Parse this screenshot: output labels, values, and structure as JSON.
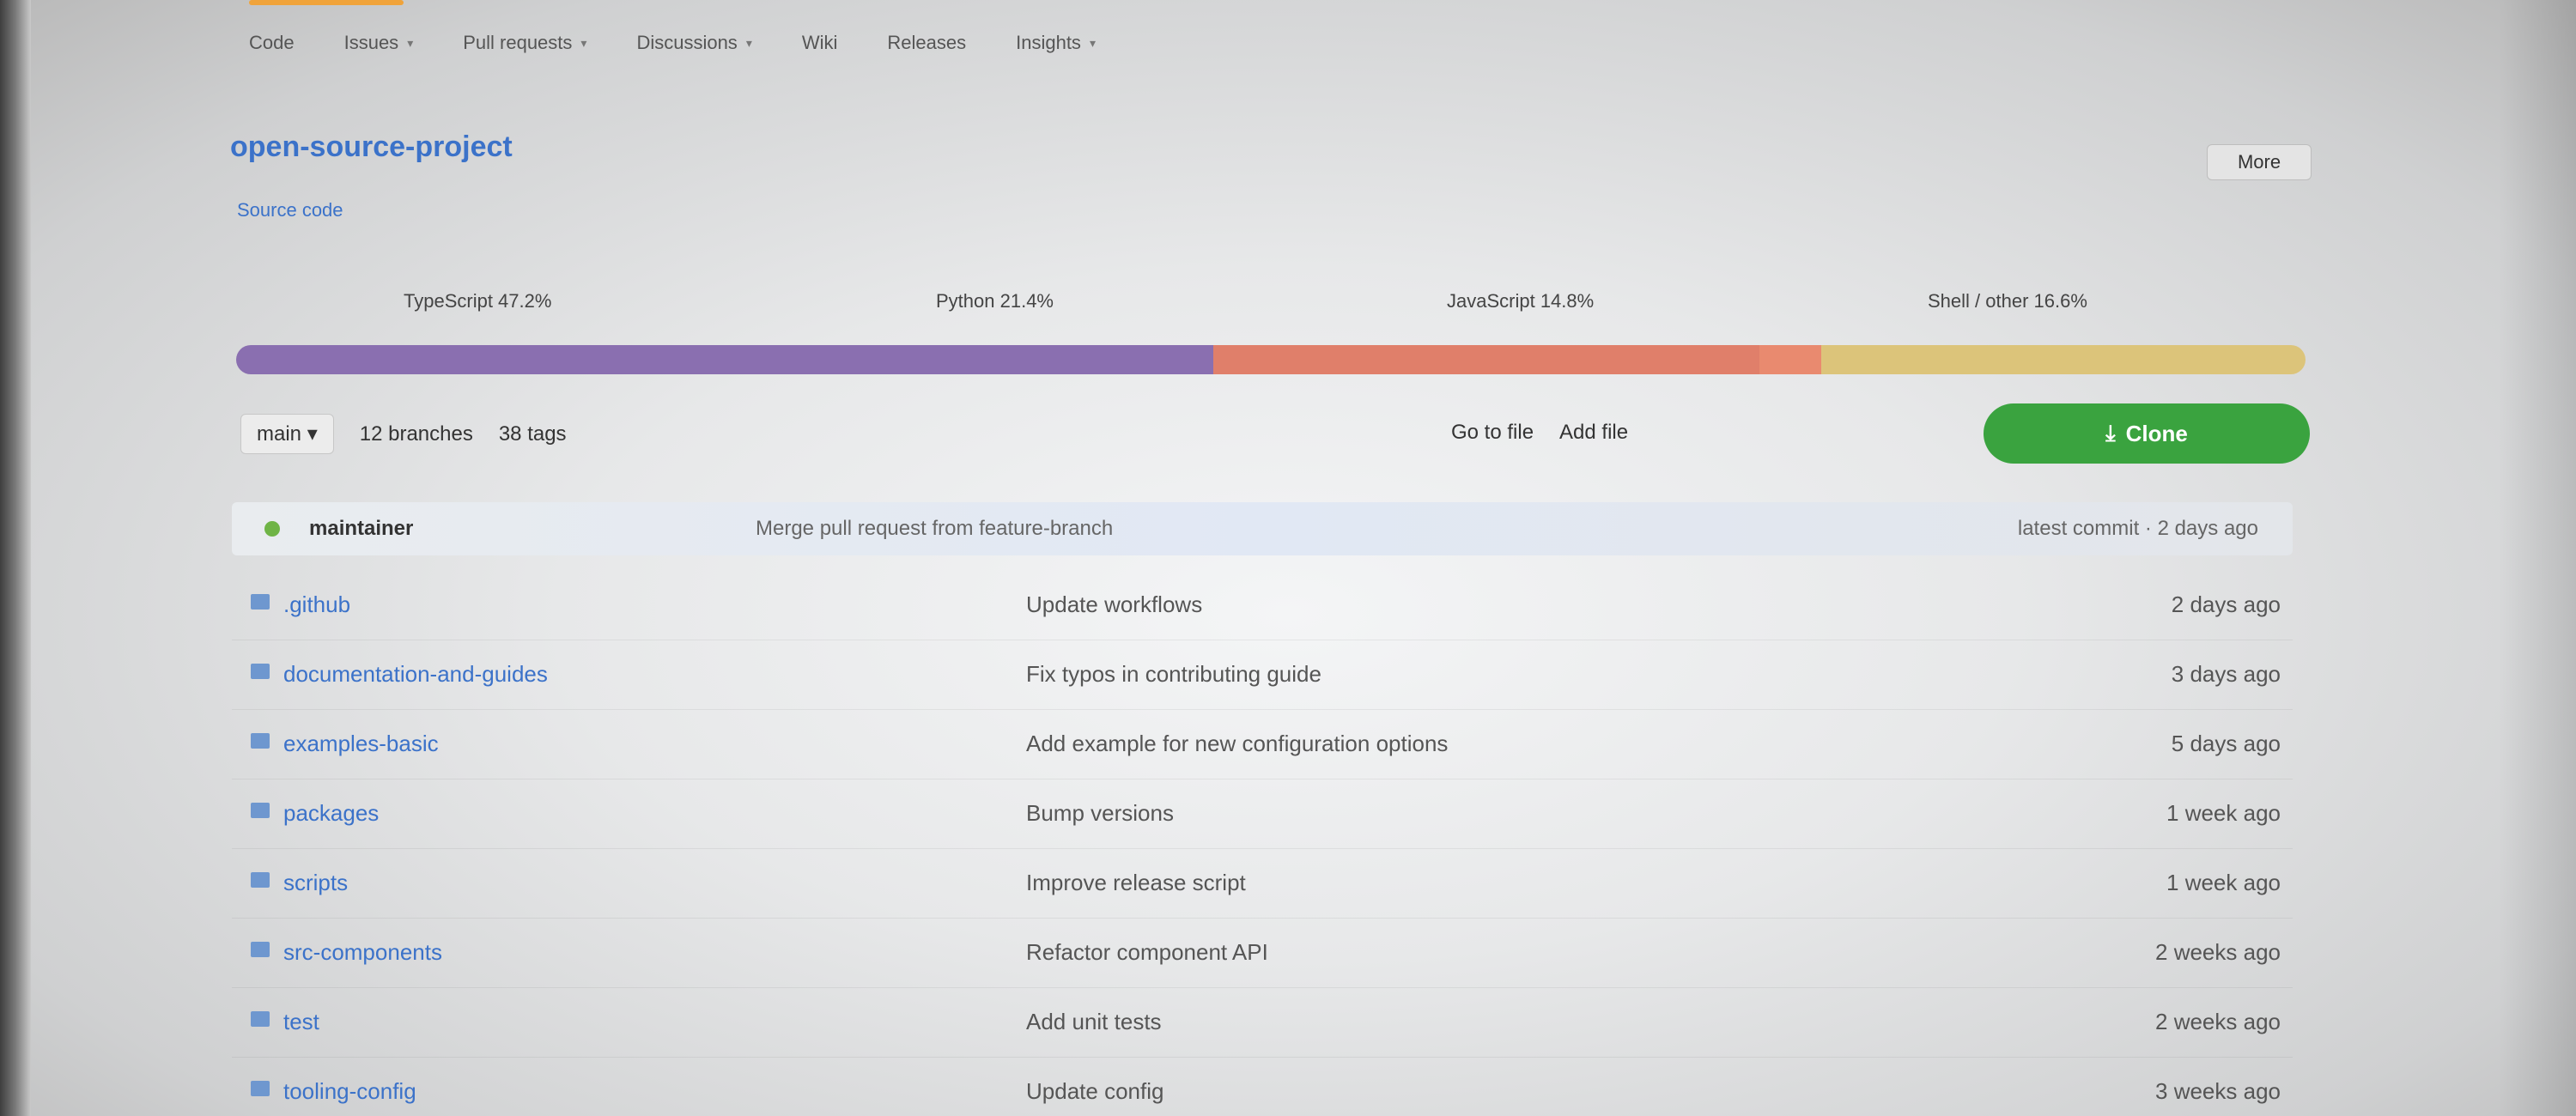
{
  "nav": {
    "items": [
      {
        "label": "Code",
        "dropdown": false
      },
      {
        "label": "Issues",
        "dropdown": true
      },
      {
        "label": "Pull requests",
        "dropdown": true
      },
      {
        "label": "Discussions",
        "dropdown": true
      },
      {
        "label": "Wiki",
        "dropdown": false
      },
      {
        "label": "Releases",
        "dropdown": false
      },
      {
        "label": "Insights",
        "dropdown": true
      }
    ],
    "accent_color": "#f0a33a"
  },
  "project": {
    "title": "open-source-project",
    "subtitle": "Source code",
    "menu_label": "More"
  },
  "languages": {
    "items": [
      {
        "name": "TypeScript 47.2%",
        "share": 0.472,
        "color": "#8a6fb0"
      },
      {
        "name": "Python 21.4%",
        "share": 0.264,
        "color": "#e07f6a"
      },
      {
        "name": "JavaScript 14.8%",
        "share": 0.03,
        "color": "#e98a6f"
      },
      {
        "name": "Shell / other 16.6%",
        "share": 0.234,
        "color": "#dcc47a"
      }
    ]
  },
  "branch": {
    "button_label": "main ▾",
    "branches_label": "12 branches",
    "tags_label": "38 tags"
  },
  "actions": {
    "go_to_file": "Go to file",
    "add_file": "Add file",
    "clone_label": "Clone",
    "clone_color": "#3aa33f"
  },
  "latest_commit": {
    "author": "maintainer",
    "message": "Merge pull request from feature-branch",
    "meta": "latest commit · 2 days ago"
  },
  "files": [
    {
      "name": ".github",
      "type": "folder",
      "message": "Update workflows",
      "age": "2 days ago"
    },
    {
      "name": "documentation-and-guides",
      "type": "folder",
      "message": "Fix typos in contributing guide",
      "age": "3 days ago"
    },
    {
      "name": "examples-basic",
      "type": "folder",
      "message": "Add example for new configuration options",
      "age": "5 days ago"
    },
    {
      "name": "packages",
      "type": "folder",
      "message": "Bump versions",
      "age": "1 week ago"
    },
    {
      "name": "scripts",
      "type": "folder",
      "message": "Improve release script",
      "age": "1 week ago"
    },
    {
      "name": "src-components",
      "type": "folder",
      "message": "Refactor component API",
      "age": "2 weeks ago"
    },
    {
      "name": "test",
      "type": "folder",
      "message": "Add unit tests",
      "age": "2 weeks ago"
    },
    {
      "name": "tooling-config",
      "type": "folder",
      "message": "Update config",
      "age": "3 weeks ago"
    }
  ]
}
